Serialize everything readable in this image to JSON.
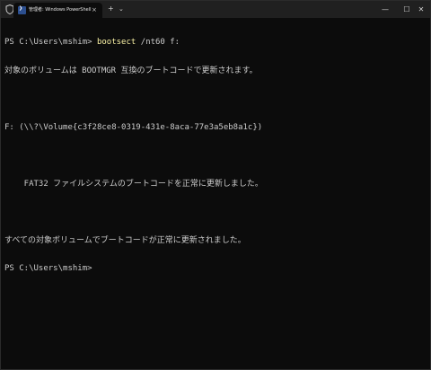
{
  "titlebar": {
    "tab_title": "管理者: Windows PowerShell",
    "tab_close": "×",
    "new_tab": "+",
    "tab_dropdown": "⌄",
    "minimize": "—",
    "maximize": "☐",
    "close": "✕",
    "tab_icon_glyph": "❯"
  },
  "terminal": {
    "line1_prompt": "PS C:\\Users\\mshim> ",
    "line1_cmd": "bootsect",
    "line1_args": " /nt60 f:",
    "line2": "対象のボリュームは BOOTMGR 互換のブートコードで更新されます。",
    "line3": "",
    "line4": "F: (\\\\?\\Volume{c3f28ce8-0319-431e-8aca-77e3a5eb8a1c})",
    "line5": "",
    "line6": "    FAT32 ファイルシステムのブートコードを正常に更新しました。",
    "line7": "",
    "line8": "すべての対象ボリュームでブートコードが正常に更新されました。",
    "line9": "PS C:\\Users\\mshim>"
  },
  "colors": {
    "background": "#0c0c0c",
    "titlebar": "#202020",
    "text": "#cccccc",
    "command": "#f9f1a5"
  }
}
